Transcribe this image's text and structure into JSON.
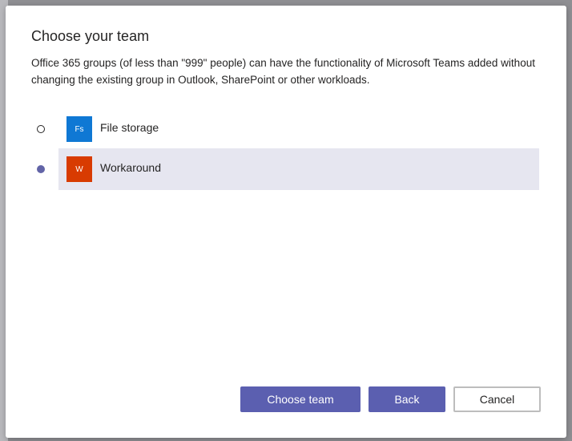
{
  "dialog": {
    "title": "Choose your team",
    "description": "Office 365 groups (of less than \"999\" people) can have the functionality of Microsoft Teams added without changing the existing group in Outlook, SharePoint or other workloads."
  },
  "teams": [
    {
      "initials": "Fs",
      "name": "File storage",
      "selected": false,
      "color": "#0f78d4"
    },
    {
      "initials": "W",
      "name": "Workaround",
      "selected": true,
      "color": "#d83b01"
    }
  ],
  "buttons": {
    "choose_label": "Choose team",
    "back_label": "Back",
    "cancel_label": "Cancel"
  },
  "colors": {
    "accent": "#5b5fb0",
    "selected_row": "#e6e6f0"
  }
}
